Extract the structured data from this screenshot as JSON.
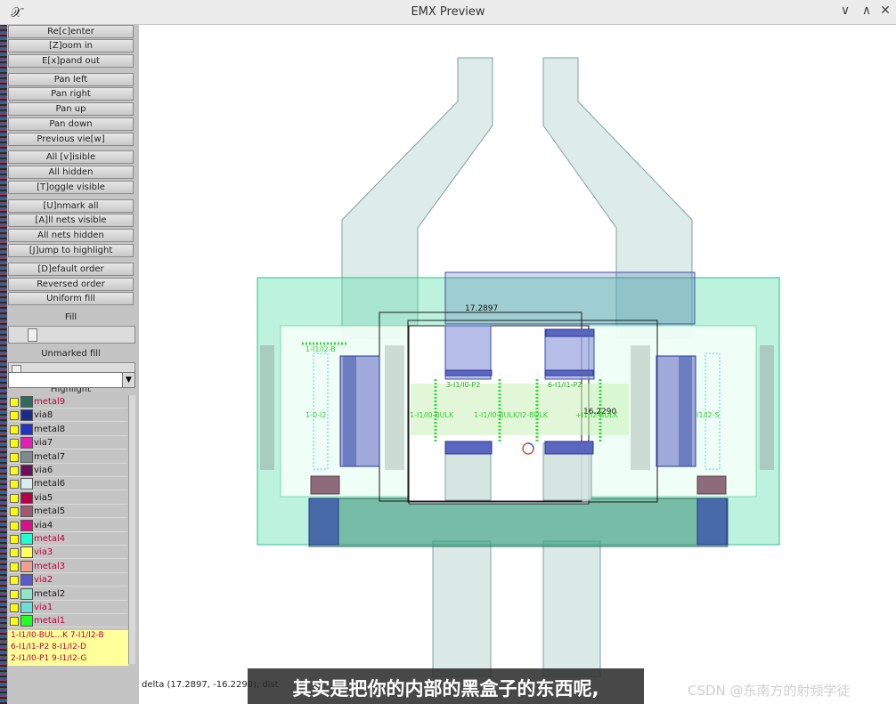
{
  "window": {
    "title": "EMX Preview",
    "app_icon": "𝒳",
    "minimize": "∨",
    "maximize": "∧",
    "close": "✕"
  },
  "buttons": {
    "recenter": "Re[c]enter",
    "zoom_in": "[Z]oom in",
    "expand_out": "E[x]pand out",
    "pan_left": "Pan left",
    "pan_right": "Pan right",
    "pan_up": "Pan up",
    "pan_down": "Pan down",
    "previous_view": "Previous vie[w]",
    "all_visible": "All [v]isible",
    "all_hidden": "All hidden",
    "toggle_visible": "[T]oggle visible",
    "unmark_all": "[U]nmark all",
    "all_nets_visible": "[A]ll nets visible",
    "all_nets_hidden": "All nets hidden",
    "jump_to_highlight": "[J]ump to highlight",
    "default_order": "[D]efault order",
    "reversed_order": "Reversed order",
    "uniform_fill": "Uniform fill"
  },
  "labels": {
    "fill": "Fill",
    "unmarked_fill": "Unmarked fill",
    "highlight": "Highlight"
  },
  "sliders": {
    "fill_level": 0.16,
    "unmarked_fill_level": 0.02
  },
  "layers": [
    {
      "name": "metal9",
      "color": "#2e6b5e",
      "marked": true
    },
    {
      "name": "via8",
      "color": "#1c2a8c",
      "marked": false
    },
    {
      "name": "metal8",
      "color": "#2233cc",
      "marked": false
    },
    {
      "name": "via7",
      "color": "#e61fb4",
      "marked": false
    },
    {
      "name": "metal7",
      "color": "#7f8c8c",
      "marked": false
    },
    {
      "name": "via6",
      "color": "#6b0f5a",
      "marked": false
    },
    {
      "name": "metal6",
      "color": "#d6eef0",
      "marked": false
    },
    {
      "name": "via5",
      "color": "#b8004a",
      "marked": false
    },
    {
      "name": "metal5",
      "color": "#a05a70",
      "marked": false
    },
    {
      "name": "via4",
      "color": "#d90f8c",
      "marked": false
    },
    {
      "name": "metal4",
      "color": "#1effd2",
      "marked": true
    },
    {
      "name": "via3",
      "color": "#ffff5a",
      "marked": true
    },
    {
      "name": "metal3",
      "color": "#f0a090",
      "marked": true
    },
    {
      "name": "via2",
      "color": "#5a5acc",
      "marked": true
    },
    {
      "name": "metal2",
      "color": "#8ce6c8",
      "marked": false
    },
    {
      "name": "via1",
      "color": "#6fdcdc",
      "marked": true
    },
    {
      "name": "metal1",
      "color": "#22ff22",
      "marked": true
    }
  ],
  "nets": [
    "1-I1/I0-BUL...K 7-I1/I2-B",
    "6-I1/I1-P2 8-I1/I2-D",
    "2-I1/I0-P1 9-I1/I2-G"
  ],
  "canvas_labels": {
    "measure_1": "17.2897",
    "measure_2": "16.2290",
    "port_a": "1-I1/I2-B",
    "port_b": "3-I1/I0-P2",
    "port_c": "6-I1/I1-P2",
    "port_d": "1-I1/I0-BULK",
    "port_e": "1-I1/I0-BULK/I2-BULK",
    "port_f": "+I1/I2-BULK",
    "port_g": "1-0-I2",
    "port_h": "I1/I2-S"
  },
  "status": {
    "text": "delta (17.2897, -16.2290), dist"
  },
  "subtitle": "其实是把你的内部的黑盒子的东西呢,",
  "watermark": "CSDN @东南方的射频学徒"
}
